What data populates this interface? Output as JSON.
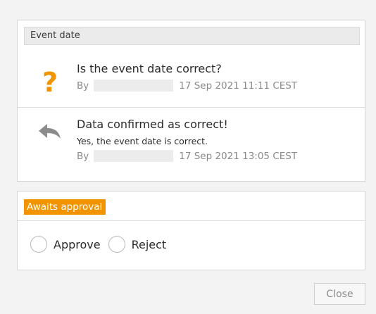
{
  "history": {
    "header": "Event date",
    "entries": [
      {
        "icon": "question-mark-icon",
        "title": "Is the event date correct?",
        "by_label": "By",
        "timestamp": "17 Sep 2021 11:11 CEST"
      },
      {
        "icon": "reply-arrow-icon",
        "title": "Data confirmed as correct!",
        "description": "Yes, the event date is correct.",
        "by_label": "By",
        "timestamp": "17 Sep 2021 13:05 CEST"
      }
    ]
  },
  "approval": {
    "status_badge": "Awaits approval",
    "options": [
      "Approve",
      "Reject"
    ]
  },
  "footer": {
    "close_label": "Close"
  },
  "colors": {
    "accent_orange": "#f29400",
    "question_icon": "#f29400",
    "reply_icon": "#8c8c8c",
    "panel_background": "#ffffff",
    "page_background": "#f3f3f3"
  }
}
